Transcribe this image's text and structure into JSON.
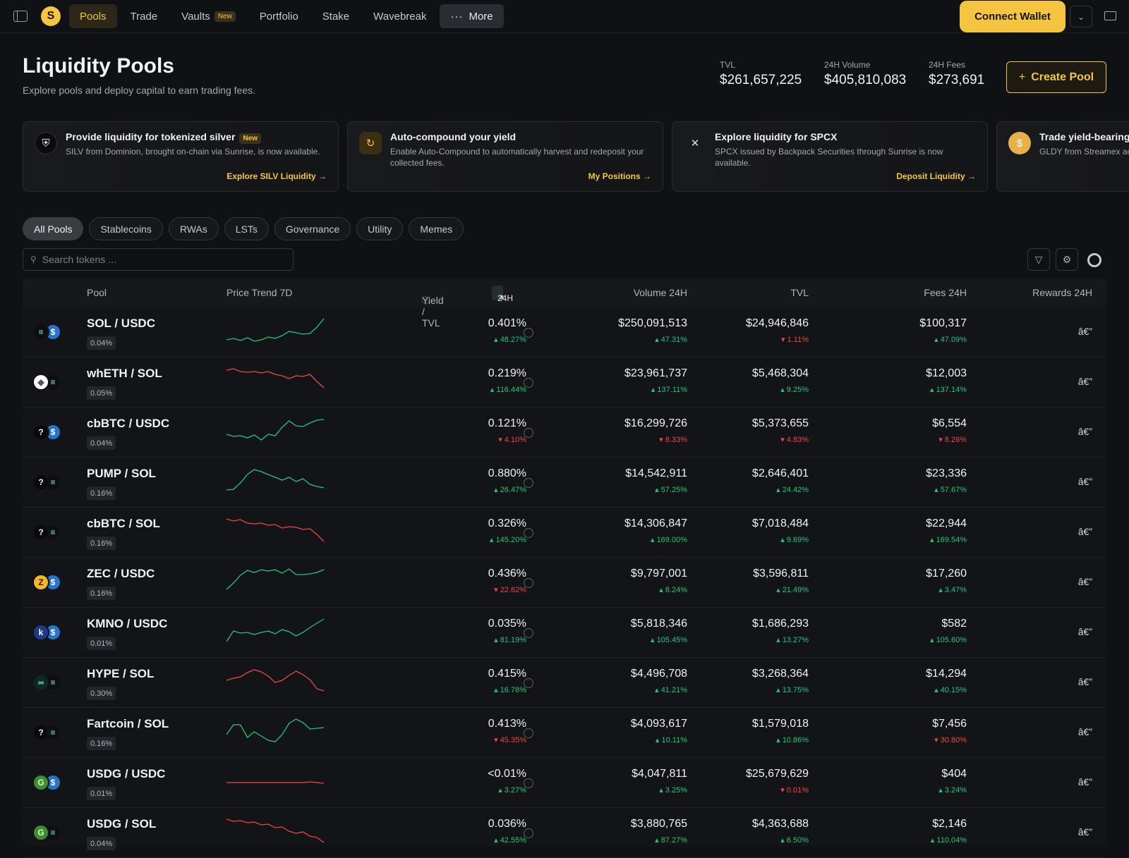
{
  "nav": {
    "items": [
      "Pools",
      "Trade",
      "Vaults",
      "Portfolio",
      "Stake",
      "Wavebreak"
    ],
    "vaults_badge": "New",
    "more_label": "More",
    "connect_label": "Connect Wallet"
  },
  "header": {
    "title": "Liquidity Pools",
    "subtitle": "Explore pools and deploy capital to earn trading fees.",
    "stats": [
      {
        "label": "TVL",
        "value": "$261,657,225"
      },
      {
        "label": "24H Volume",
        "value": "$405,810,083"
      },
      {
        "label": "24H Fees",
        "value": "$273,691"
      }
    ],
    "create_label": "Create Pool"
  },
  "cards": [
    {
      "title": "Provide liquidity for tokenized silver",
      "badge": "New",
      "desc": "SILV from Dominion, brought on-chain via Sunrise, is now available.",
      "link": "Explore SILV Liquidity"
    },
    {
      "title": "Auto-compound your yield",
      "desc": "Enable Auto-Compound to automatically harvest and redeposit your collected fees.",
      "link": "My Positions"
    },
    {
      "title": "Explore liquidity for SPCX",
      "desc": "SPCX issued by Backpack Securities through Sunrise is now available.",
      "link": "Deposit Liquidity"
    },
    {
      "title": "Trade yield-bearing",
      "desc": "GLDY from Streamex accredited investors."
    }
  ],
  "filters": [
    "All Pools",
    "Stablecoins",
    "RWAs",
    "LSTs",
    "Governance",
    "Utility",
    "Memes"
  ],
  "search": {
    "placeholder": "Search tokens ..."
  },
  "table": {
    "headers": {
      "pool": "Pool",
      "trend": "Price Trend 7D",
      "yield": "Yield / TVL",
      "timeframe": "24H",
      "volume": "Volume 24H",
      "tvl": "TVL",
      "fees": "Fees 24H",
      "rewards": "Rewards 24H"
    },
    "rows": [
      {
        "pair": "SOL / USDC",
        "fee": "0.04%",
        "yield": "0.401%",
        "yield_chg": "48.27%",
        "yield_up": true,
        "vol": "$250,091,513",
        "vol_chg": "47.31%",
        "vol_up": true,
        "tvl": "$24,946,846",
        "tvl_chg": "1.11%",
        "tvl_up": false,
        "fees": "$100,317",
        "fees_chg": "47.09%",
        "fees_up": true,
        "rewards": "â€”",
        "trend_up": true,
        "spark": [
          30,
          28,
          31,
          27,
          32,
          30,
          26,
          28,
          24,
          18,
          20,
          22,
          21,
          12,
          0
        ]
      },
      {
        "pair": "whETH / SOL",
        "fee": "0.05%",
        "yield": "0.219%",
        "yield_chg": "116.44%",
        "yield_up": true,
        "vol": "$23,961,737",
        "vol_chg": "137.11%",
        "vol_up": true,
        "tvl": "$5,468,304",
        "tvl_chg": "9.25%",
        "tvl_up": true,
        "fees": "$12,003",
        "fees_chg": "137.14%",
        "fees_up": true,
        "rewards": "â€”",
        "trend_up": false,
        "spark": [
          2,
          0,
          4,
          5,
          4,
          6,
          4,
          8,
          10,
          14,
          10,
          11,
          8,
          18,
          27
        ]
      },
      {
        "pair": "cbBTC / USDC",
        "fee": "0.04%",
        "yield": "0.121%",
        "yield_chg": "4.10%",
        "yield_up": false,
        "vol": "$16,299,726",
        "vol_chg": "8.33%",
        "vol_up": false,
        "tvl": "$5,373,655",
        "tvl_chg": "4.83%",
        "tvl_up": false,
        "fees": "$6,554",
        "fees_chg": "8.26%",
        "fees_up": false,
        "rewards": "â€”",
        "trend_up": true,
        "spark": [
          22,
          25,
          24,
          27,
          23,
          30,
          22,
          24,
          12,
          3,
          10,
          11,
          6,
          2,
          1
        ]
      },
      {
        "pair": "PUMP / SOL",
        "fee": "0.16%",
        "yield": "0.880%",
        "yield_chg": "26.47%",
        "yield_up": true,
        "vol": "$14,542,911",
        "vol_chg": "57.25%",
        "vol_up": true,
        "tvl": "$2,646,401",
        "tvl_chg": "24.42%",
        "tvl_up": true,
        "fees": "$23,336",
        "fees_chg": "57.67%",
        "fees_up": true,
        "rewards": "â€”",
        "trend_up": true,
        "spark": [
          30,
          29,
          20,
          8,
          1,
          4,
          8,
          12,
          16,
          12,
          18,
          14,
          22,
          25,
          27
        ]
      },
      {
        "pair": "cbBTC / SOL",
        "fee": "0.16%",
        "yield": "0.326%",
        "yield_chg": "145.20%",
        "yield_up": true,
        "vol": "$14,306,847",
        "vol_chg": "169.00%",
        "vol_up": true,
        "tvl": "$7,018,484",
        "tvl_chg": "9.69%",
        "tvl_up": true,
        "fees": "$22,944",
        "fees_chg": "169.54%",
        "fees_up": true,
        "rewards": "â€”",
        "trend_up": false,
        "spark": [
          0,
          3,
          1,
          6,
          7,
          6,
          9,
          8,
          13,
          11,
          12,
          15,
          14,
          22,
          32
        ]
      },
      {
        "pair": "ZEC / USDC",
        "fee": "0.16%",
        "yield": "0.436%",
        "yield_chg": "22.62%",
        "yield_up": false,
        "vol": "$9,797,001",
        "vol_chg": "8.24%",
        "vol_up": true,
        "tvl": "$3,596,811",
        "tvl_chg": "21.49%",
        "tvl_up": true,
        "fees": "$17,260",
        "fees_chg": "3.47%",
        "fees_up": true,
        "rewards": "â€”",
        "trend_up": true,
        "spark": [
          29,
          20,
          9,
          2,
          5,
          1,
          3,
          1,
          6,
          0,
          8,
          8,
          7,
          5,
          1
        ]
      },
      {
        "pair": "KMNO / USDC",
        "fee": "0.01%",
        "yield": "0.035%",
        "yield_chg": "81.19%",
        "yield_up": true,
        "vol": "$5,818,346",
        "vol_chg": "105.45%",
        "vol_up": true,
        "tvl": "$1,686,293",
        "tvl_chg": "13.27%",
        "tvl_up": true,
        "fees": "$582",
        "fees_chg": "105.60%",
        "fees_up": true,
        "rewards": "â€”",
        "trend_up": true,
        "spark": [
          32,
          17,
          20,
          19,
          22,
          19,
          17,
          21,
          15,
          18,
          24,
          19,
          12,
          6,
          0
        ]
      },
      {
        "pair": "HYPE / SOL",
        "fee": "0.30%",
        "yield": "0.415%",
        "yield_chg": "16.78%",
        "yield_up": true,
        "vol": "$4,496,708",
        "vol_chg": "41.21%",
        "vol_up": true,
        "tvl": "$3,268,364",
        "tvl_chg": "13.75%",
        "tvl_up": true,
        "fees": "$14,294",
        "fees_chg": "40.15%",
        "fees_up": true,
        "rewards": "â€”",
        "trend_up": false,
        "spark": [
          16,
          13,
          11,
          5,
          1,
          4,
          10,
          19,
          16,
          9,
          3,
          8,
          15,
          28,
          31
        ]
      },
      {
        "pair": "Fartcoin / SOL",
        "fee": "0.16%",
        "yield": "0.413%",
        "yield_chg": "45.35%",
        "yield_up": false,
        "vol": "$4,093,617",
        "vol_chg": "10.11%",
        "vol_up": true,
        "tvl": "$1,579,018",
        "tvl_chg": "10.86%",
        "tvl_up": true,
        "fees": "$7,456",
        "fees_chg": "30.80%",
        "fees_up": false,
        "rewards": "â€”",
        "trend_up": true,
        "spark": [
          22,
          8,
          8,
          26,
          18,
          24,
          30,
          32,
          22,
          6,
          0,
          5,
          14,
          13,
          12
        ]
      },
      {
        "pair": "USDG / USDC",
        "fee": "0.01%",
        "yield": "<0.01%",
        "yield_chg": "3.27%",
        "yield_up": true,
        "vol": "$4,047,811",
        "vol_chg": "3.25%",
        "vol_up": true,
        "tvl": "$25,679,629",
        "tvl_chg": "0.01%",
        "tvl_up": false,
        "fees": "$404",
        "fees_chg": "3.24%",
        "fees_up": true,
        "rewards": "â€”",
        "trend_up": false,
        "spark": [
          19,
          19,
          19,
          19,
          19,
          19,
          19,
          19,
          19,
          19,
          19,
          19,
          18,
          19,
          20
        ]
      },
      {
        "pair": "USDG / SOL",
        "fee": "0.04%",
        "yield": "0.036%",
        "yield_chg": "42.55%",
        "yield_up": true,
        "vol": "$3,880,765",
        "vol_chg": "87.27%",
        "vol_up": true,
        "tvl": "$4,363,688",
        "tvl_chg": "6.50%",
        "tvl_up": true,
        "fees": "$2,146",
        "fees_chg": "110.04%",
        "fees_up": true,
        "rewards": "â€”",
        "trend_up": false,
        "spark": [
          0,
          3,
          2,
          5,
          4,
          8,
          7,
          12,
          11,
          17,
          20,
          18,
          24,
          26,
          33
        ]
      }
    ]
  },
  "token_icons": [
    [
      "sol",
      "usdc"
    ],
    [
      "eth",
      "sol"
    ],
    [
      "unknown",
      "usdc"
    ],
    [
      "unknown",
      "sol"
    ],
    [
      "unknown",
      "sol"
    ],
    [
      "zec",
      "usdc"
    ],
    [
      "kmno",
      "usdc"
    ],
    [
      "hype",
      "sol"
    ],
    [
      "unknown",
      "sol"
    ],
    [
      "usdg",
      "usdc"
    ],
    [
      "usdg",
      "sol"
    ]
  ],
  "colors": {
    "accent": "#f5c542",
    "up": "#22c77a",
    "down": "#ef4646",
    "bg": "#101114"
  }
}
